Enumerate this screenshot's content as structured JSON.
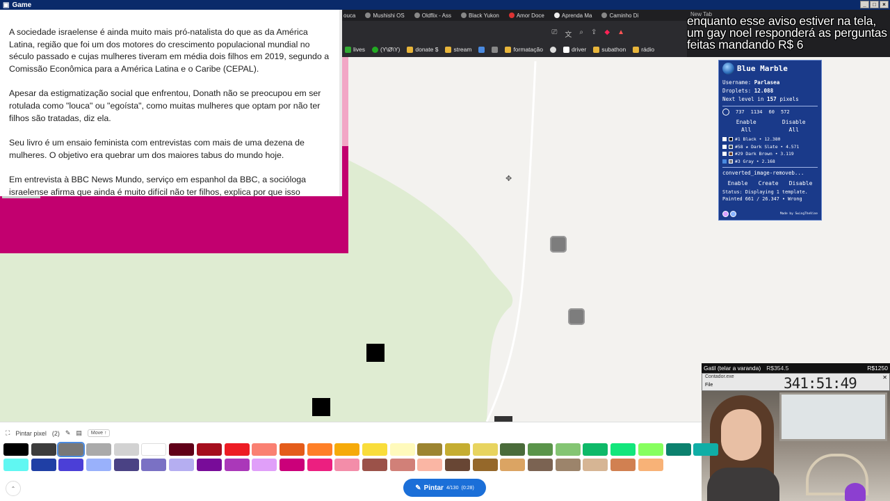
{
  "window": {
    "title": "Game",
    "icon": "game-icon"
  },
  "article": {
    "paragraphs": [
      "A sociedade israelense é ainda muito mais pró-natalista do que as da América Latina, região que foi um dos motores do crescimento populacional mundial no século passado e cujas mulheres tiveram em média dois filhos em 2019, segundo a Comissão Econômica para a América Latina e o Caribe (CEPAL).",
      "Apesar da estigmatização social que enfrentou, Donath não se preocupou em ser rotulada como \"louca\" ou \"egoísta\", como muitas mulheres que optam por não ter filhos são tratadas, diz ela.",
      "Seu livro é um ensaio feminista com entrevistas com mais de uma dezena de mulheres. O objetivo era quebrar um dos maiores tabus do mundo hoje.",
      "Em entrevista à BBC News Mundo, serviço em espanhol da BBC, a socióloga israelense afirma que ainda é muito difícil não ter filhos, explica por que isso"
    ]
  },
  "browser": {
    "tabs": [
      "ouca",
      "Mushishi OS",
      "Oldflix - Ass",
      "Black Yukon",
      "Amor Doce",
      "Aprenda Ma",
      "Caminho Di"
    ],
    "new_tab": "New Tab",
    "bookmarks": [
      "lives",
      "(Y\\Ø\\Y)",
      "donate $",
      "stream",
      "formatação",
      "driver",
      "subathon",
      "rádio"
    ]
  },
  "stream_banner": "enquanto esse aviso estiver na tela, um gay noel responderá as perguntas feitas mandando R$ 6",
  "blue_marble": {
    "title": "Blue Marble",
    "username_label": "Username:",
    "username": "Parlasea",
    "droplets_label": "Droplets:",
    "droplets": "12.088",
    "next_level": "Next level in",
    "next_level_pixels": "157",
    "next_level_unit": "pixels",
    "coords": [
      "737",
      "1134",
      "60",
      "572"
    ],
    "enable_all": "Enable All",
    "disable_all": "Disable All",
    "colors": [
      {
        "label": "#1 Black • 12.380",
        "checked": false,
        "swatch": "#000000"
      },
      {
        "label": "#58 ★ Dark Slate • 4.571",
        "checked": false,
        "swatch": "#3b4a55"
      },
      {
        "label": "#29 Dark Brown • 3.119",
        "checked": false,
        "swatch": "#6b4226"
      },
      {
        "label": "#3 Gray • 2.168",
        "checked": true,
        "swatch": "#7b7b7b"
      }
    ],
    "template_file": "converted_image-removeb...",
    "enable": "Enable",
    "create": "Create",
    "disable": "Disable",
    "status": "Status: Displaying 1 template.",
    "painted": "Painted 661 / 26.347 • Wrong",
    "footer": "Made by SwingTheVine"
  },
  "tracker": {
    "goal_label": "Gatil (telar a varanda)",
    "goal_amount": "R$354.5",
    "goal_total": "R$1250",
    "timer_window": "Contador.exe",
    "timer_menu": "File",
    "timer_value": "341:51:49"
  },
  "palette": {
    "mode_label": "Pintar pixel",
    "mode_count": "(2)",
    "move_label": "Move ↑",
    "paint_button": "Pintar",
    "paint_count": "4/130",
    "paint_timer": "(0:28)",
    "row1": [
      "#000000",
      "#3c3c3c",
      "#787878",
      "#aaaaaa",
      "#d2d2d2",
      "#ffffff",
      "#600018",
      "#a50e1e",
      "#ed1c24",
      "#fa8072",
      "#e45c1a",
      "#ff7f27",
      "#f6aa09",
      "#f9dd3b",
      "#fffabc",
      "#9c8431",
      "#c5ad31",
      "#e8d45f",
      "#4a6b3a",
      "#5a944a",
      "#84c573",
      "#0eb968",
      "#13e67b",
      "#87ff5e",
      "#0c816e",
      "#10aea6"
    ],
    "row2": [
      "#60f7f2",
      "#1f3fa5",
      "#4b3fd7",
      "#99b1fb",
      "#4a4284",
      "#7a71c4",
      "#b5aef1",
      "#780c99",
      "#aa38b9",
      "#e09ff9",
      "#cb007a",
      "#ec1f80",
      "#f38da9",
      "#9b5249",
      "#d18078",
      "#fab6a4",
      "#684634",
      "#95682a",
      "#dba463",
      "#7b6352",
      "#9c846b",
      "#d6b594",
      "#d18051",
      "#f8b277"
    ],
    "selected": "#787878"
  }
}
